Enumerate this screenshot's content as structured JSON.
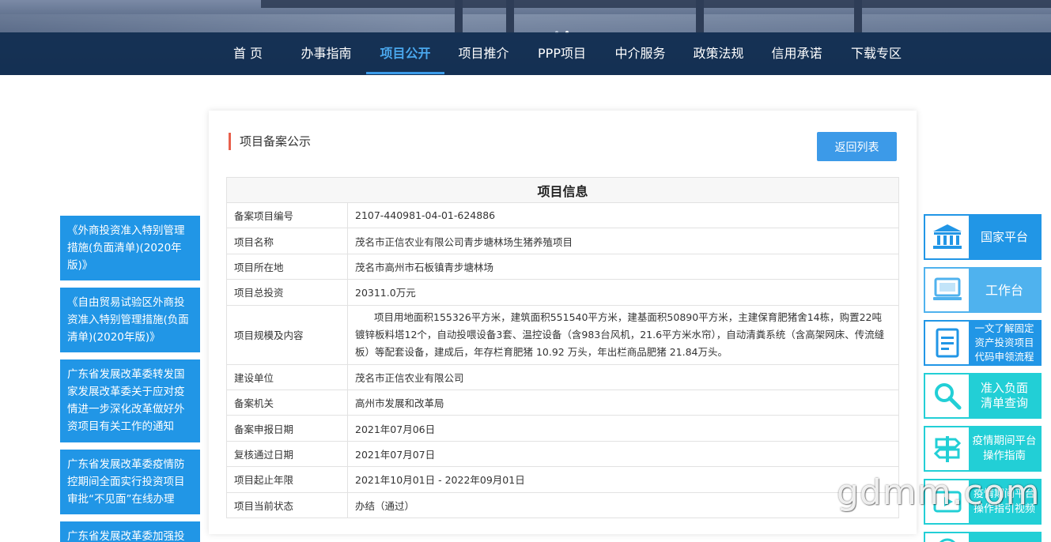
{
  "nav": {
    "items": [
      "首 页",
      "办事指南",
      "项目公开",
      "项目推介",
      "PPP项目",
      "中介服务",
      "政策法规",
      "信用承诺",
      "下载专区"
    ],
    "active_index": 2
  },
  "card": {
    "title": "项目备案公示",
    "back_button": "返回列表",
    "table_header": "项目信息",
    "rows": [
      {
        "label": "备案项目编号",
        "value": "2107-440981-04-01-624886"
      },
      {
        "label": "项目名称",
        "value": "茂名市正信农业有限公司青步塘林场生猪养殖项目"
      },
      {
        "label": "项目所在地",
        "value": "茂名市高州市石板镇青步塘林场"
      },
      {
        "label": "项目总投资",
        "value": "20311.0万元"
      },
      {
        "label": "项目规模及内容",
        "value": "项目用地面积155326平方米，建筑面积551540平方米，建基面积50890平方米，主建保育肥猪舍14栋，购置22吨镀锌板料塔12个，自动投喂设备3套、温控设备（含983台风机，21.6平方米水帘），自动清粪系统（含高架网床、传流缝板）等配套设备，建成后，年存栏育肥猪 10.92 万头，年出栏商品肥猪 21.84万头。"
      },
      {
        "label": "建设单位",
        "value": "茂名市正信农业有限公司"
      },
      {
        "label": "备案机关",
        "value": "高州市发展和改革局"
      },
      {
        "label": "备案申报日期",
        "value": "2021年07月06日"
      },
      {
        "label": "复核通过日期",
        "value": "2021年07月07日"
      },
      {
        "label": "项目起止年限",
        "value": "2021年10月01日 - 2022年09月01日"
      },
      {
        "label": "项目当前状态",
        "value": "办结（通过）"
      }
    ]
  },
  "left_links": [
    "《外商投资准入特别管理措施(负面清单)(2020年版)》",
    "《自由贸易试验区外商投资准入特别管理措施(负面清单)(2020年版)》",
    "广东省发展改革委转发国家发展改革委关于应对疫情进一步深化改革做好外资项目有关工作的通知",
    "广东省发展改革委疫情防控期间全面实行投资项目审批“不见面”在线办理",
    "广东省发展改革委加强投"
  ],
  "right_panel": [
    {
      "label": "国家平台",
      "icon": "institution-icon"
    },
    {
      "label": "工作台",
      "icon": "computer-icon"
    },
    {
      "label": "一文了解固定资产投资项目代码申领流程",
      "icon": "document-icon"
    },
    {
      "label": "准入负面清单查询",
      "icon": "search-icon"
    },
    {
      "label": "疫情期间平台操作指南",
      "icon": "signpost-icon"
    },
    {
      "label": "疫情期间平台操作指引视频",
      "icon": "video-icon"
    }
  ],
  "watermark": "gdmm.com",
  "colors": {
    "primary": "#2196e6",
    "accent_bar": "#e8604c",
    "cyan": "#22cfd6",
    "nav_bg": "#143052"
  }
}
